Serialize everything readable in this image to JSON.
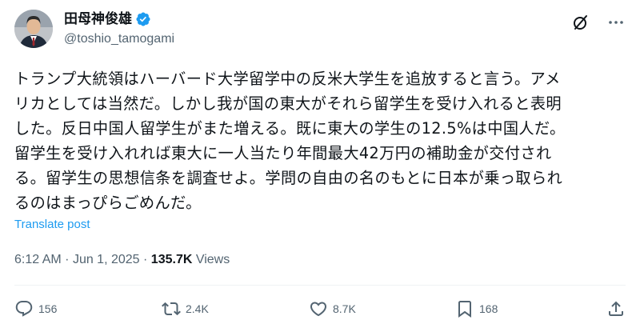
{
  "author": {
    "display_name": "田母神俊雄",
    "handle": "@toshio_tamogami",
    "verified": true
  },
  "header_icons": {
    "grok": "grok-slash-icon",
    "more": "more-horizontal-icon"
  },
  "tweet": {
    "lines": [
      "トランプ大統領はハーバード大学留学中の反米大学生を追放すると言う。アメ",
      "リカとしては当然だ。しかし我が国の東大がそれら留学生を受け入れると表明",
      "した。反日中国人留学生がまた増える。既に東大の学生の12.5%は中国人だ。",
      "留学生を受け入れれば東大に一人当たり年間最大42万円の補助金が交付され",
      "る。留学生の思想信条を調査せよ。学問の自由の名のもとに日本が乗っ取られ",
      "るのはまっぴらごめんだ。"
    ],
    "translate_label": "Translate post"
  },
  "meta": {
    "time": "6:12 AM",
    "separator": "·",
    "date": "Jun 1, 2025",
    "views_count": "135.7K",
    "views_label": "Views"
  },
  "actions": {
    "reply_count": "156",
    "retweet_count": "2.4K",
    "like_count": "8.7K",
    "bookmark_count": "168"
  },
  "colors": {
    "text": "#0f1419",
    "secondary": "#536471",
    "link": "#1d9bf0",
    "divider": "#eff3f4"
  }
}
